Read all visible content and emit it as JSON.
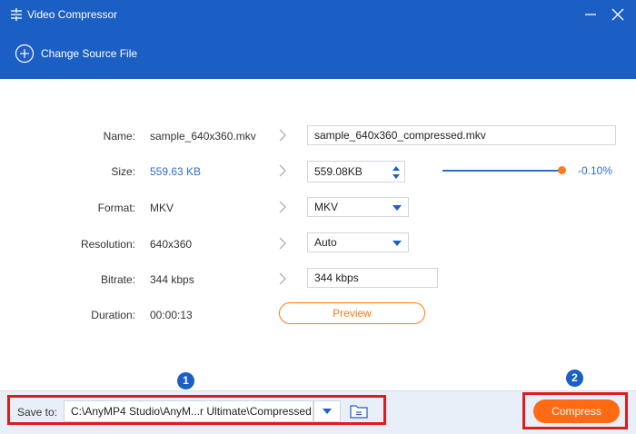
{
  "window": {
    "title": "Video Compressor",
    "icon": "compress-sliders-icon"
  },
  "source": {
    "change_label": "Change Source File",
    "icon": "plus-circle-icon"
  },
  "fields": {
    "name": {
      "label": "Name:",
      "source": "sample_640x360.mkv",
      "output": "sample_640x360_compressed.mkv"
    },
    "size": {
      "label": "Size:",
      "source": "559.63 KB",
      "output": "559.08KB",
      "slider_percent": "-0.10%",
      "slider_level": 0.999
    },
    "format": {
      "label": "Format:",
      "source": "MKV",
      "selected": "MKV"
    },
    "resolution": {
      "label": "Resolution:",
      "source": "640x360",
      "selected": "Auto"
    },
    "bitrate": {
      "label": "Bitrate:",
      "source": "344 kbps",
      "output": "344 kbps"
    },
    "duration": {
      "label": "Duration:",
      "value": "00:00:13"
    }
  },
  "preview": {
    "label": "Preview"
  },
  "save": {
    "label": "Save to:",
    "path": "C:\\AnyMP4 Studio\\AnyM...r Ultimate\\Compressed"
  },
  "compress": {
    "label": "Compress"
  },
  "markers": {
    "one": "1",
    "two": "2"
  },
  "colors": {
    "brand_blue": "#1c5fc4",
    "accent_orange": "#ff6a13",
    "highlight_red": "#e01b1b"
  }
}
